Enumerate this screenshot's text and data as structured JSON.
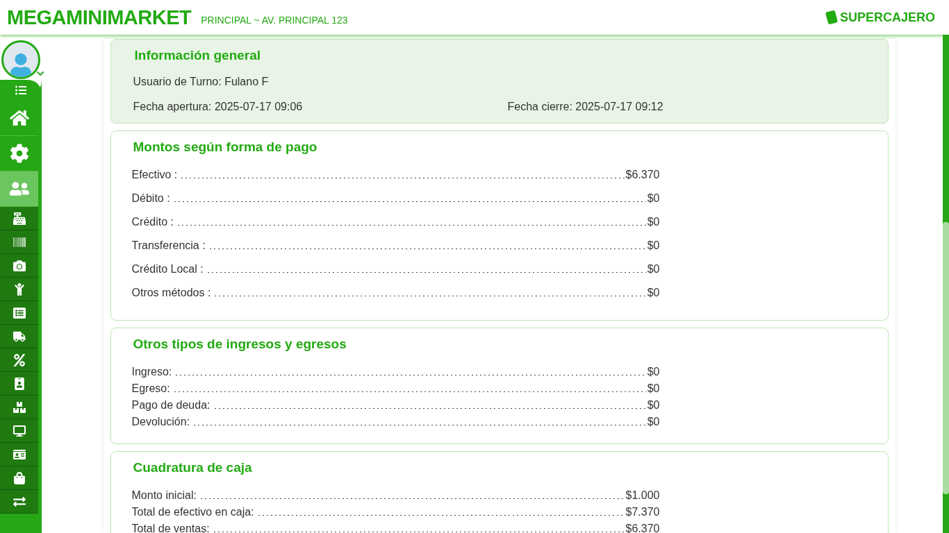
{
  "header": {
    "brand": "MEGAMINIMARKET",
    "branch": "PRINCIPAL ~ AV. PRINCIPAL 123",
    "logo_text": "SUPERCAJERO"
  },
  "sidebar": {
    "items": [
      {
        "kind": "large",
        "selected": false
      },
      {
        "kind": "large",
        "selected": false
      },
      {
        "kind": "large",
        "selected": true
      },
      {
        "kind": "small",
        "selected": false
      },
      {
        "kind": "small",
        "selected": false
      },
      {
        "kind": "small",
        "selected": false
      },
      {
        "kind": "small",
        "selected": false
      },
      {
        "kind": "small",
        "selected": false
      },
      {
        "kind": "small",
        "selected": false
      },
      {
        "kind": "small",
        "selected": false
      },
      {
        "kind": "small",
        "selected": false
      },
      {
        "kind": "small",
        "selected": false
      },
      {
        "kind": "small",
        "selected": false
      },
      {
        "kind": "small",
        "selected": false
      },
      {
        "kind": "small",
        "selected": false
      },
      {
        "kind": "small",
        "selected": false
      }
    ]
  },
  "sections": [
    {
      "kind": "info",
      "title": "Información general",
      "user": "Usuario de Turno: Fulano F",
      "opened": "Fecha apertura: 2025-07-17 09:06",
      "closed": "Fecha cierre: 2025-07-17 09:12"
    },
    {
      "kind": "amounts",
      "title": "Montos según forma de pago",
      "rows": [
        {
          "label": "Efectivo :",
          "value": "$6.370"
        },
        {
          "label": "Débito :",
          "value": "$0"
        },
        {
          "label": "Crédito :",
          "value": "$0"
        },
        {
          "label": "Transferencia :",
          "value": "$0"
        },
        {
          "label": "Crédito Local :",
          "value": "$0"
        },
        {
          "label": "Otros métodos :",
          "value": "$0"
        }
      ]
    },
    {
      "kind": "compact_amounts",
      "title": "Otros tipos de ingresos y egresos",
      "rows": [
        {
          "label": "Ingreso:",
          "value": "$0"
        },
        {
          "label": "Egreso:",
          "value": "$0"
        },
        {
          "label": "Pago de deuda:",
          "value": "$0"
        },
        {
          "label": "Devolución:",
          "value": "$0"
        }
      ]
    },
    {
      "kind": "compact_amounts",
      "title": "Cuadratura de caja",
      "rows": [
        {
          "label": "Monto inicial:",
          "value": "$1.000"
        },
        {
          "label": "Total de efectivo en caja:",
          "value": "$7.370"
        },
        {
          "label": "Total de ventas:",
          "value": "$6.370"
        }
      ]
    }
  ]
}
